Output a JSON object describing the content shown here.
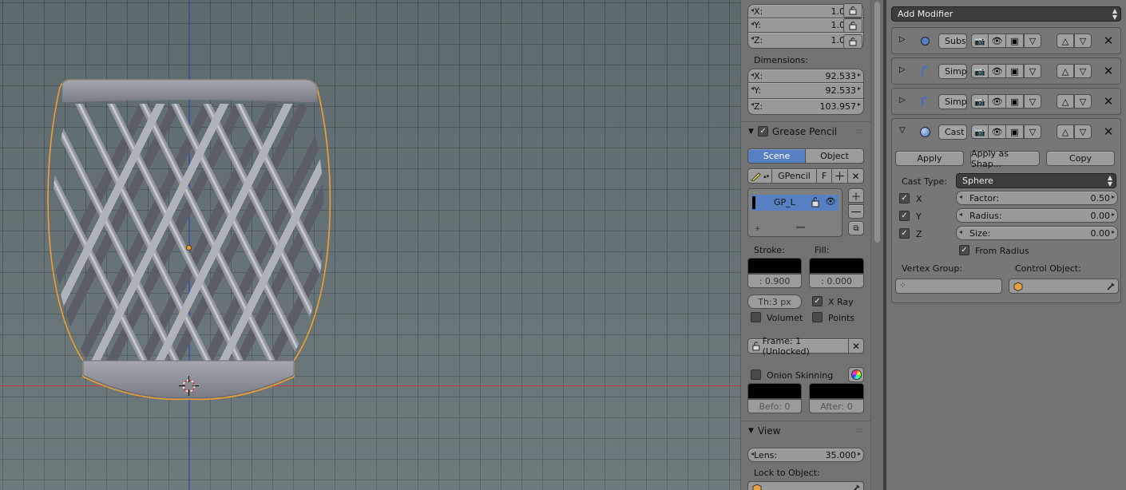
{
  "properties": {
    "scale": [
      {
        "label": "X:",
        "value": "1.000"
      },
      {
        "label": "Y:",
        "value": "1.000"
      },
      {
        "label": "Z:",
        "value": "1.000"
      }
    ],
    "dimensions_label": "Dimensions:",
    "dimensions": [
      {
        "label": "X:",
        "value": "92.533"
      },
      {
        "label": "Y:",
        "value": "92.533"
      },
      {
        "label": "Z:",
        "value": "103.957"
      }
    ],
    "grease_pencil": {
      "title": "Grease Pencil",
      "tabs": [
        "Scene",
        "Object"
      ],
      "datablock": "GPencil",
      "fake_user": "F",
      "layer_name": "GP_L",
      "stroke_label": "Stroke:",
      "fill_label": "Fill:",
      "stroke_value": ": 0.900",
      "fill_value": ": 0.000",
      "thickness": "Th:3 px",
      "xray": "X Ray",
      "volumetric": "Volumet",
      "points": "Points",
      "frame": "Frame: 1 (Unlocked)",
      "onion_skinning": "Onion Skinning",
      "before": "Befo: 0",
      "after": "After: 0"
    },
    "view": {
      "title": "View",
      "lens_label": "Lens:",
      "lens_value": "35.000",
      "lock_to_object": "Lock to Object:"
    }
  },
  "modifiers": {
    "add_modifier": "Add Modifier",
    "stack": [
      {
        "name": "Subs",
        "icon": "subsurf-icon"
      },
      {
        "name": "Simp",
        "icon": "simple-deform-icon"
      },
      {
        "name": "Simp",
        "icon": "simple-deform-icon"
      },
      {
        "name": "Cast",
        "icon": "cast-icon"
      }
    ],
    "cast": {
      "apply": "Apply",
      "apply_as_shape": "Apply as Shap...",
      "copy": "Copy",
      "cast_type_label": "Cast Type:",
      "cast_type_value": "Sphere",
      "x": "X",
      "y": "Y",
      "z": "Z",
      "factor_label": "Factor:",
      "factor_value": "0.50",
      "radius_label": "Radius:",
      "radius_value": "0.00",
      "size_label": "Size:",
      "size_value": "0.00",
      "from_radius": "From Radius",
      "vertex_group_label": "Vertex Group:",
      "control_object_label": "Control Object:"
    }
  },
  "colors": {
    "accent": "#5680c2",
    "selection_outline": "#f0a030",
    "x_axis": "#c23a3a",
    "y_axis": "#3a4fd0"
  }
}
